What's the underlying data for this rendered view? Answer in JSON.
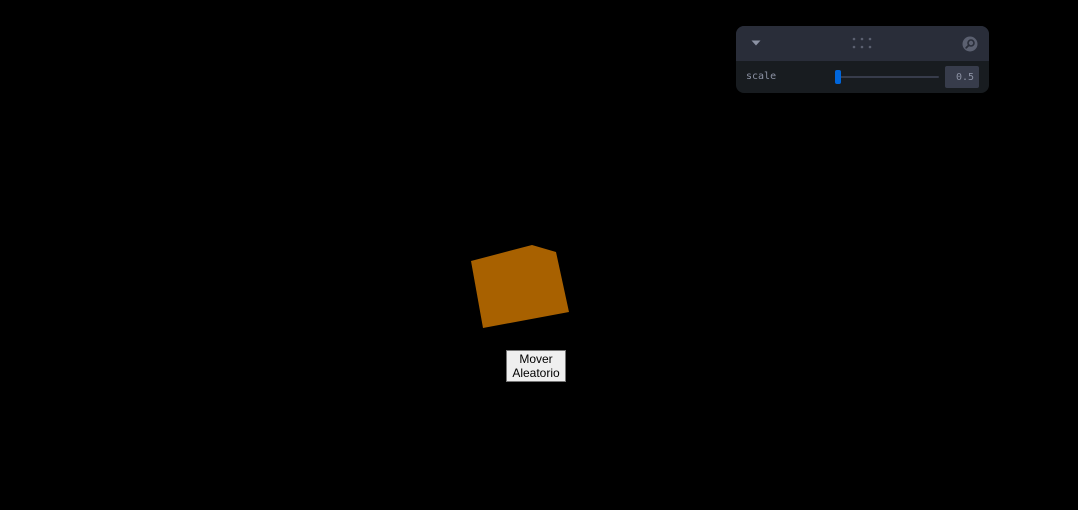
{
  "scene": {
    "cube_color": "#a86100",
    "background": "#000000"
  },
  "action_button": {
    "line1": "Mover",
    "line2": "Aleatorio"
  },
  "panel": {
    "collapse_icon": "chevron-down-icon",
    "drag_icon": "drag-dots-icon",
    "search_icon": "search-icon",
    "controls": [
      {
        "label": "scale",
        "value": "0.5",
        "slider_fraction": 0.02
      }
    ],
    "colors": {
      "accent": "#0066dc",
      "panel_bg": "#181c20",
      "header_bg": "#292d39",
      "text": "#8c92a4"
    }
  }
}
